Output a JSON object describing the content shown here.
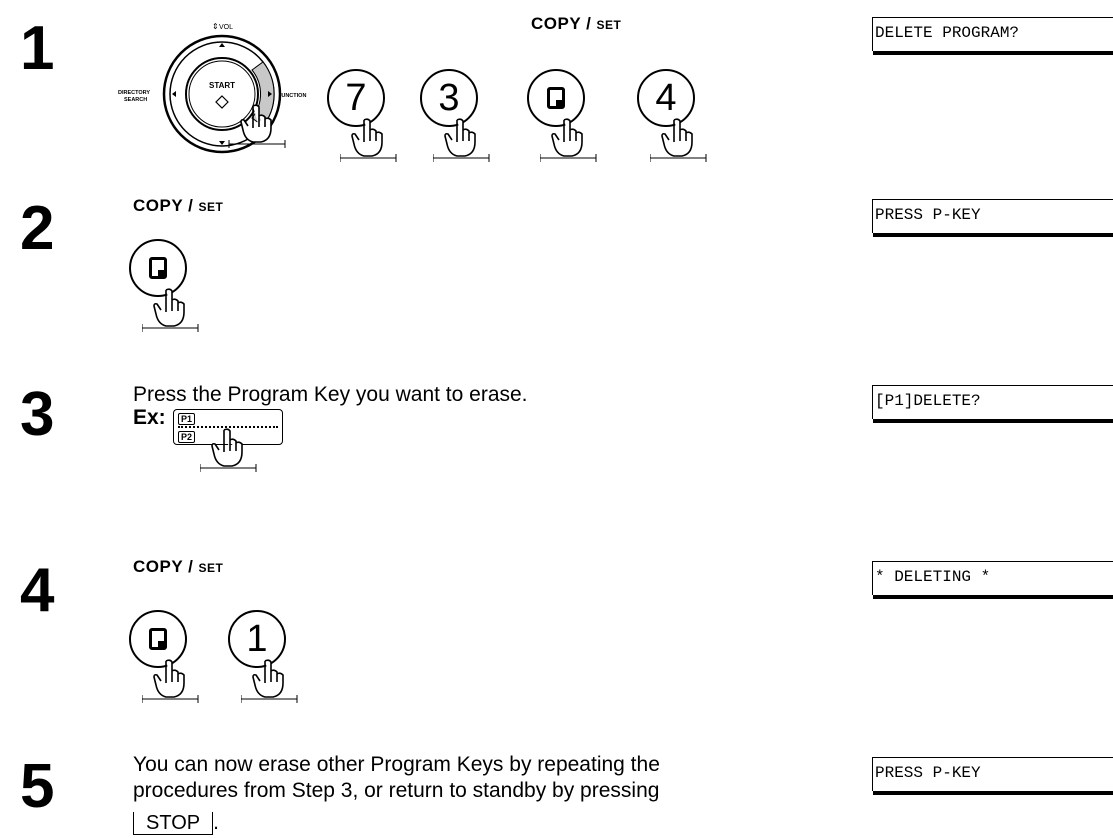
{
  "steps": [
    {
      "number": "1",
      "key_label": {
        "main": "COPY",
        "sep": " / ",
        "set": "SET"
      },
      "keys": [
        "7",
        "3",
        "4"
      ],
      "lcd": "DELETE PROGRAM?"
    },
    {
      "number": "2",
      "key_label": {
        "main": "COPY",
        "sep": " / ",
        "set": "SET"
      },
      "lcd": "PRESS P-KEY"
    },
    {
      "number": "3",
      "text": "Press the Program Key you want to erase.",
      "ex_label": "Ex:",
      "panel_keys": [
        "P1",
        "P2"
      ],
      "lcd": "[P1]DELETE?"
    },
    {
      "number": "4",
      "key_label": {
        "main": "COPY",
        "sep": " / ",
        "set": "SET"
      },
      "keys": [
        "1"
      ],
      "lcd": "* DELETING *"
    },
    {
      "number": "5",
      "text_line1": "You can now erase other Program Keys by repeating the",
      "text_line2": "procedures from Step 3, or return to standby by pressing",
      "stop_label": "STOP",
      "stop_suffix": ".",
      "lcd": "PRESS P-KEY"
    }
  ],
  "dial": {
    "vol_label": "VOL",
    "start_label": "START",
    "left_label_1": "DIRECTORY",
    "left_label_2": "SEARCH",
    "right_label": "FUNCTION"
  }
}
